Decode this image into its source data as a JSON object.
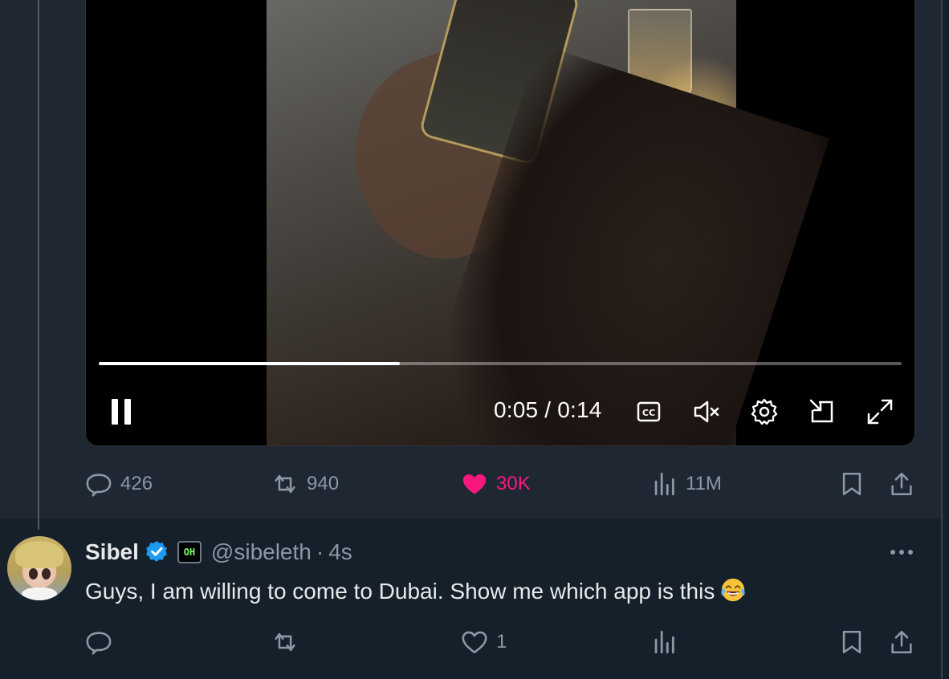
{
  "video": {
    "progress_fraction": 0.375,
    "time": "0:05 / 0:14",
    "controls": [
      "pause-icon",
      "captions-icon",
      "mute-icon",
      "settings-icon",
      "pip-icon",
      "fullscreen-icon"
    ]
  },
  "main_tweet": {
    "actions": {
      "replies": "426",
      "reposts": "940",
      "likes": "30K",
      "views": "11M"
    }
  },
  "reply": {
    "name": "Sibel",
    "affiliate_badge": "OH",
    "handle": "@sibeleth",
    "separator": "·",
    "time": "4s",
    "text": "Guys, I am willing to come to Dubai. Show me which app is this",
    "actions": {
      "replies": "",
      "reposts": "",
      "likes": "1",
      "views": ""
    }
  },
  "colors": {
    "background": "#15202b",
    "hover_background": "#1e2732",
    "secondary_text": "#8b98a5",
    "like_active": "#f91880",
    "verified": "#1d9bf0"
  }
}
